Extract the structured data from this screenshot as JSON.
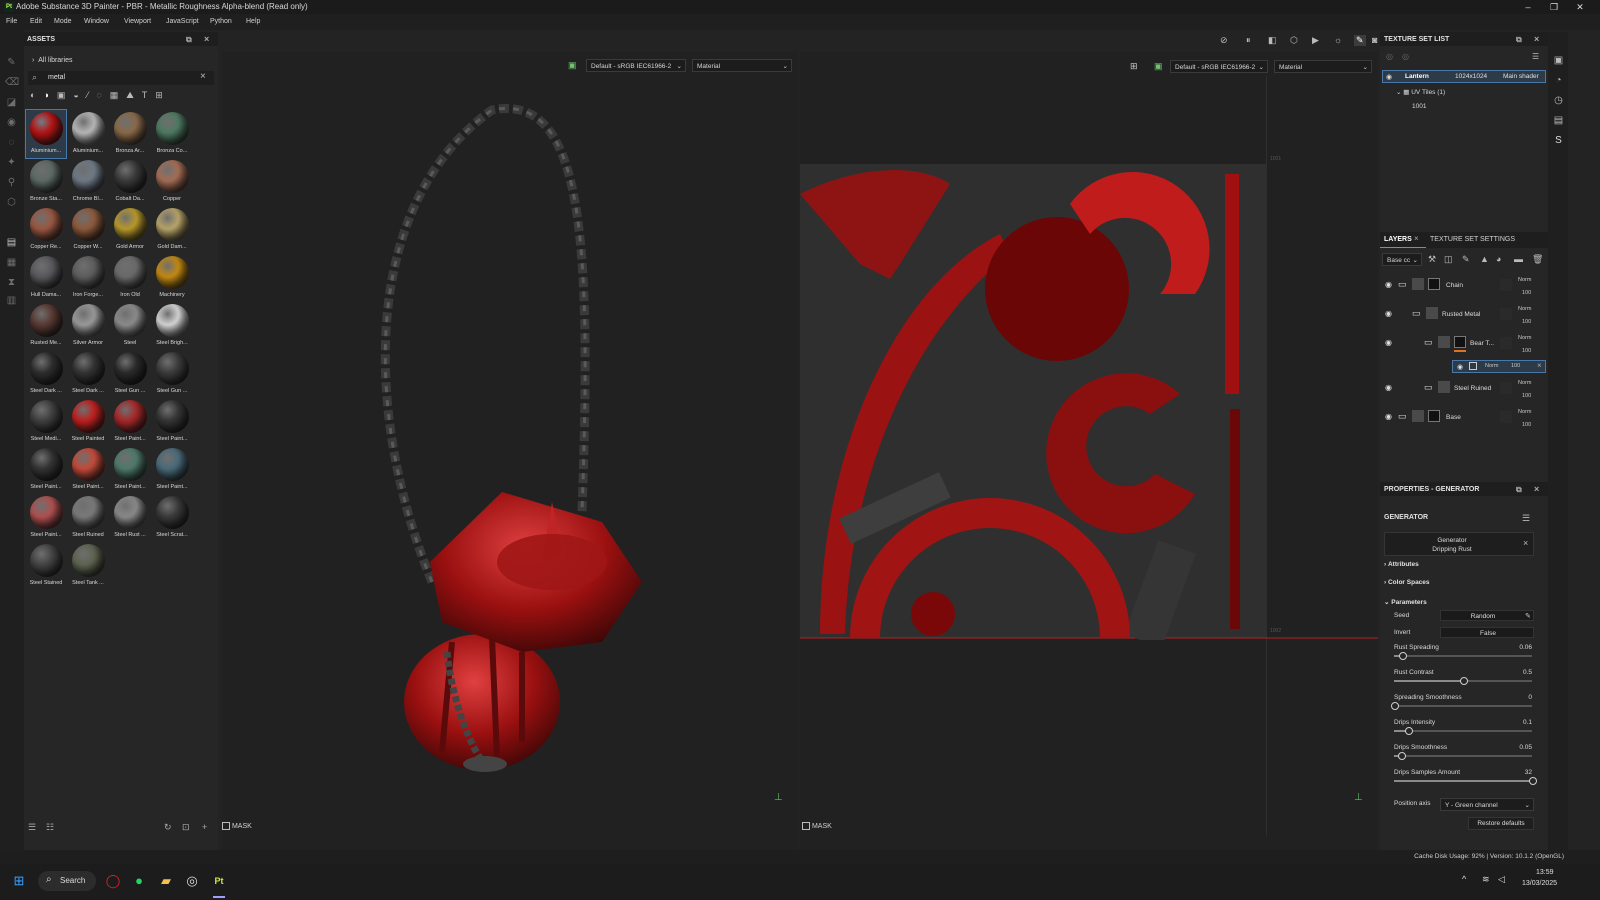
{
  "window": {
    "title": "Adobe Substance 3D Painter - PBR - Metallic Roughness Alpha-blend (Read only)",
    "logo": "Pt"
  },
  "menu": [
    "File",
    "Edit",
    "Mode",
    "Window",
    "Viewport",
    "JavaScript",
    "Python",
    "Help"
  ],
  "assets": {
    "title": "ASSETS",
    "library": "All libraries",
    "search_value": "metal",
    "materials": [
      {
        "label": "Aluminium...",
        "color": "#b51414"
      },
      {
        "label": "Aluminium...",
        "color": "#b8b8b8"
      },
      {
        "label": "Bronza Ar...",
        "color": "#8a6a4a"
      },
      {
        "label": "Bronza Co...",
        "color": "#4e7a62"
      },
      {
        "label": "Bronze Sta...",
        "color": "#5d6a66"
      },
      {
        "label": "Chrome Bl...",
        "color": "#6f7a86"
      },
      {
        "label": "Cobalt Da...",
        "color": "#3a3a3a"
      },
      {
        "label": "Copper",
        "color": "#a56d55"
      },
      {
        "label": "Copper Re...",
        "color": "#9b5842"
      },
      {
        "label": "Copper W...",
        "color": "#8e5a3c"
      },
      {
        "label": "Gold Armor",
        "color": "#b99a2a"
      },
      {
        "label": "Gold Dam...",
        "color": "#b8a56a"
      },
      {
        "label": "Hull Dama...",
        "color": "#5a5a5e"
      },
      {
        "label": "Iron Forge...",
        "color": "#5e5e5e"
      },
      {
        "label": "Iron Old",
        "color": "#6a6a6a"
      },
      {
        "label": "Machinery",
        "color": "#c48a12"
      },
      {
        "label": "Rusted Me...",
        "color": "#5a3a34"
      },
      {
        "label": "Silver Armor",
        "color": "#9a9a9a"
      },
      {
        "label": "Steel",
        "color": "#8c8c8c"
      },
      {
        "label": "Steel Brigh...",
        "color": "#d4d4d4"
      },
      {
        "label": "Steel Dark ...",
        "color": "#2e2e2e"
      },
      {
        "label": "Steel Dark ...",
        "color": "#333333"
      },
      {
        "label": "Steel Gun ...",
        "color": "#2a2a2a"
      },
      {
        "label": "Steel Gun ...",
        "color": "#3c3c3c"
      },
      {
        "label": "Steel Medi...",
        "color": "#404040"
      },
      {
        "label": "Steel Painted",
        "color": "#c02020"
      },
      {
        "label": "Steel Paint...",
        "color": "#a8282a"
      },
      {
        "label": "Steel Paint...",
        "color": "#353535"
      },
      {
        "label": "Steel Paint...",
        "color": "#333333"
      },
      {
        "label": "Steel Paint...",
        "color": "#c44a3a"
      },
      {
        "label": "Steel Paint...",
        "color": "#4e7a6a"
      },
      {
        "label": "Steel Paint...",
        "color": "#4a6a7a"
      },
      {
        "label": "Steel Paint...",
        "color": "#b05050"
      },
      {
        "label": "Steel Ruined",
        "color": "#7a7a7a"
      },
      {
        "label": "Steel Rust ...",
        "color": "#8a8a8a"
      },
      {
        "label": "Steel Scrat...",
        "color": "#3a3a3a"
      },
      {
        "label": "Steel Stained",
        "color": "#444444"
      },
      {
        "label": "Steel Tank ...",
        "color": "#5e6450"
      }
    ]
  },
  "viewport3d": {
    "colorspace": "Default - sRGB IEC61966-2",
    "channel": "Material",
    "mask_label": "MASK"
  },
  "viewport2d": {
    "colorspace": "Default - sRGB IEC61966-2",
    "channel": "Material",
    "mask_label": "MASK",
    "tile_label_top": "1001",
    "tile_label_bottom": "1002"
  },
  "texture_set_list": {
    "title": "TEXTURE SET LIST",
    "row": {
      "name": "Lantern",
      "resolution": "1024x1024",
      "shader": "Main shader"
    },
    "uv_tiles": "UV Tiles (1)",
    "tile": "1001"
  },
  "layers": {
    "tab_layers": "LAYERS",
    "tab_settings": "TEXTURE SET SETTINGS",
    "channel": "Base cc",
    "items": [
      {
        "name": "Chain",
        "blend": "Norm",
        "opacity": "100"
      },
      {
        "name": "Rusted Metal",
        "blend": "Norm",
        "opacity": "100"
      },
      {
        "name": "Bear T...",
        "blend": "Norm",
        "opacity": "100"
      },
      {
        "name": "Steel Ruined",
        "blend": "Norm",
        "opacity": "100"
      },
      {
        "name": "Base",
        "blend": "Norm",
        "opacity": "100"
      }
    ],
    "effect": {
      "blend": "Norm",
      "opacity": "100"
    }
  },
  "properties": {
    "title": "PROPERTIES - GENERATOR",
    "section": "GENERATOR",
    "gen_name": "Generator",
    "gen_sub": "Dripping Rust",
    "groups": [
      "Attributes",
      "Color Spaces",
      "Parameters"
    ],
    "seed_label": "Seed",
    "seed_value": "Random",
    "invert_label": "Invert",
    "invert_value": "False",
    "sliders": [
      {
        "label": "Rust Spreading",
        "value": "0.06",
        "fraction": 0.06
      },
      {
        "label": "Rust Contrast",
        "value": "0.5",
        "fraction": 0.5
      },
      {
        "label": "Spreading Smoothness",
        "value": "0",
        "fraction": 0.0
      },
      {
        "label": "Drips Intensity",
        "value": "0.1",
        "fraction": 0.1
      },
      {
        "label": "Drips Smoothness",
        "value": "0.05",
        "fraction": 0.05
      },
      {
        "label": "Drips Samples Amount",
        "value": "32",
        "fraction": 1.0
      }
    ],
    "position_axis_label": "Position axis",
    "position_axis_value": "Y - Green channel",
    "restore": "Restore defaults"
  },
  "status": {
    "text": "Cache Disk Usage:  92% | Version: 10.1.2 (OpenGL)"
  },
  "taskbar": {
    "search": "Search",
    "time": "13:59",
    "date": "13/03/2025"
  }
}
